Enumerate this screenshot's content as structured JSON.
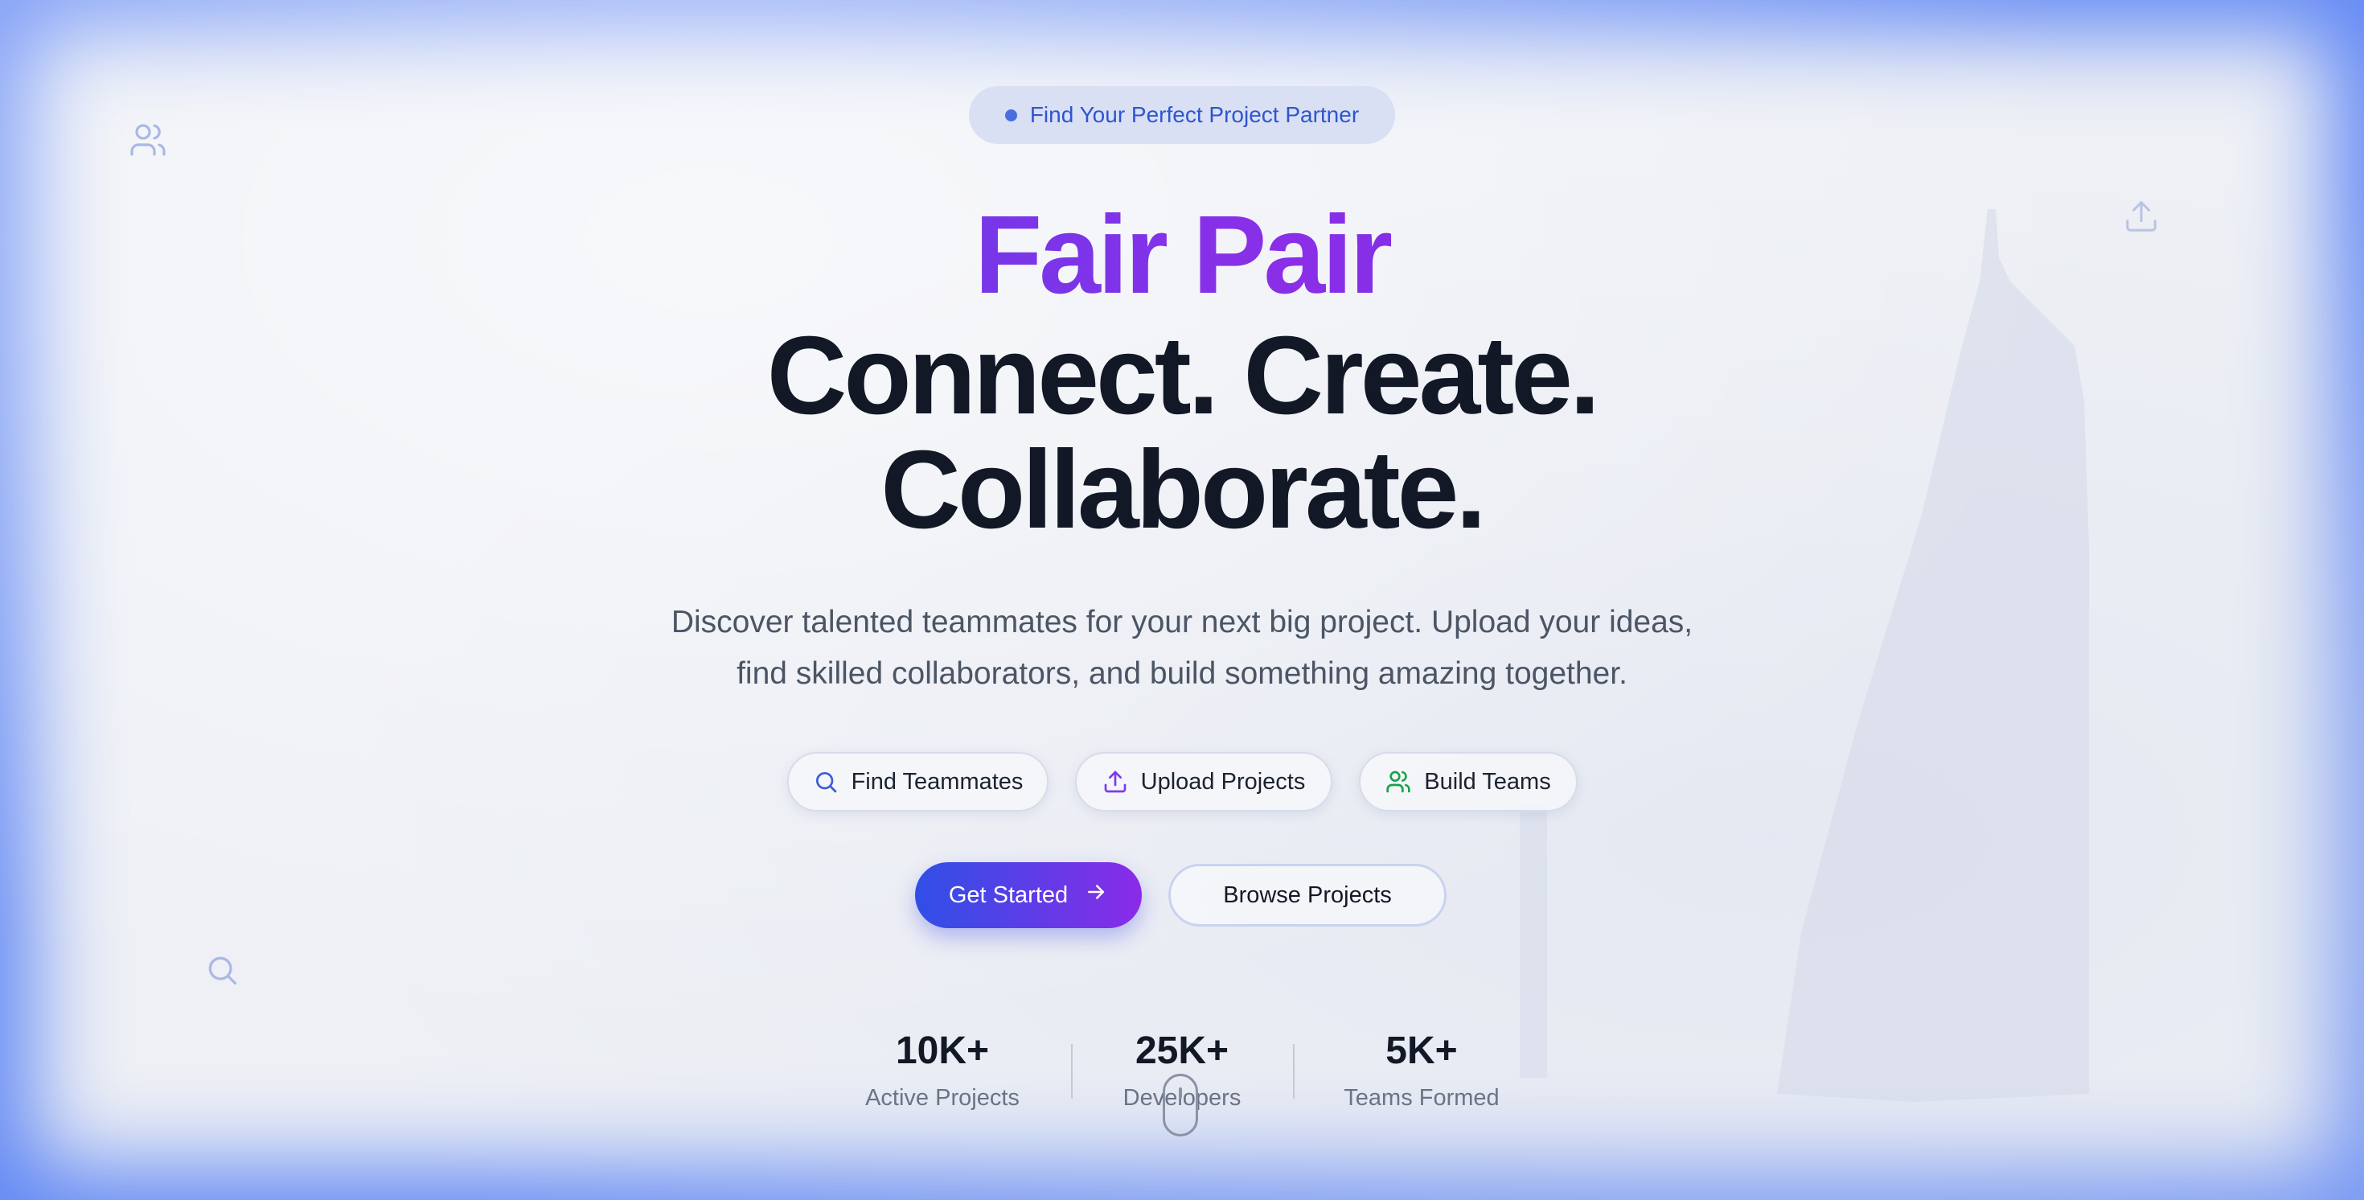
{
  "badge": {
    "label": "Find Your Perfect Project Partner"
  },
  "hero": {
    "brand": "Fair Pair",
    "line1": "Connect. Create.",
    "line2": "Collaborate.",
    "subtitle_line1": "Discover talented teammates for your next big project. Upload your ideas,",
    "subtitle_line2": "find skilled collaborators, and build something amazing together."
  },
  "features": [
    {
      "label": "Find Teammates",
      "icon": "search-icon",
      "color": "#3b5bdb"
    },
    {
      "label": "Upload Projects",
      "icon": "upload-icon",
      "color": "#7c3aed"
    },
    {
      "label": "Build Teams",
      "icon": "users-icon",
      "color": "#16a34a"
    }
  ],
  "cta": {
    "primary": "Get Started",
    "secondary": "Browse Projects"
  },
  "stats": [
    {
      "value": "10K+",
      "label": "Active Projects"
    },
    {
      "value": "25K+",
      "label": "Developers"
    },
    {
      "value": "5K+",
      "label": "Teams Formed"
    }
  ],
  "colors": {
    "frame_glow": "#5f86f4",
    "background": "#eef0f5",
    "brand_gradient_start": "#3a52e8",
    "brand_gradient_end": "#8b2ee8",
    "heading": "#121826"
  }
}
